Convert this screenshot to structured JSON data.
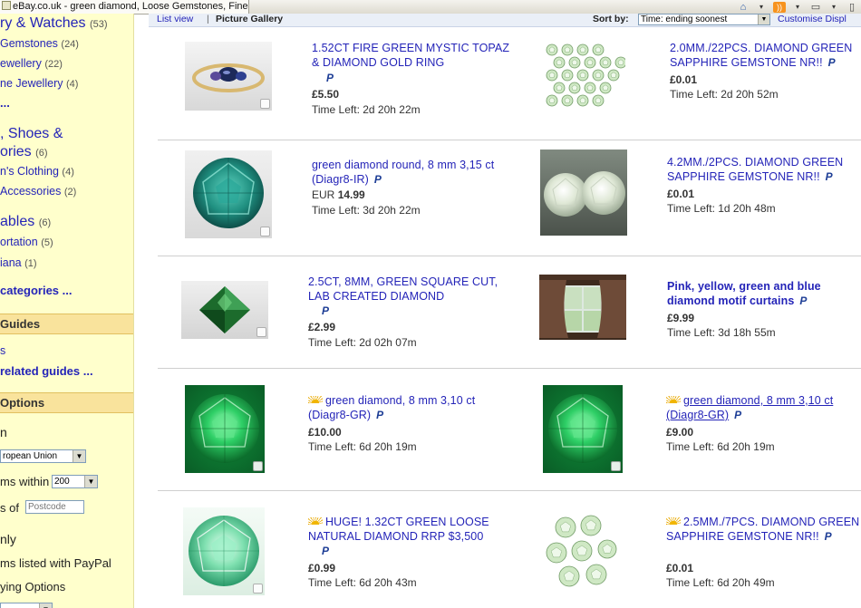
{
  "browser": {
    "tab_title": "eBay.co.uk - green diamond, Loose Gemstones, Fine ...",
    "icons": [
      "home-icon",
      "rss-icon",
      "print-icon"
    ]
  },
  "sidebar": {
    "categories": [
      {
        "label": "ry & Watches",
        "count": "(53)",
        "size": "large"
      },
      {
        "label": "Gemstones",
        "count": "(24)"
      },
      {
        "label": "ewellery",
        "count": "(22)"
      },
      {
        "label": "ne Jewellery",
        "count": "(4)"
      },
      {
        "label": "..."
      },
      {
        "label": ", Shoes &",
        "size": "large"
      },
      {
        "label": "ories",
        "count": "(6)",
        "size": "large"
      },
      {
        "label": "n's Clothing",
        "count": "(4)"
      },
      {
        "label": "Accessories",
        "count": "(2)"
      },
      {
        "label": "ables",
        "count": "(6)",
        "size": "large"
      },
      {
        "label": "ortation",
        "count": "(5)"
      },
      {
        "label": "iana",
        "count": "(1)"
      }
    ],
    "more_categories": "categories ...",
    "guides_header": "Guides",
    "guides_link": "s",
    "related_guides": "related guides ...",
    "options_header": "Options",
    "options_n": "n",
    "location_select": "ropean Union",
    "items_within_label": "ms within",
    "distance_select": "200",
    "postcode_label": "s of",
    "postcode_placeholder": "Postcode",
    "only_label": "nly",
    "paypal_label": "ms listed with PayPal",
    "buying_options": "ying Options"
  },
  "viewbar": {
    "list_view": "List view",
    "separator": "|",
    "picture_gallery": "Picture Gallery",
    "sort_label": "Sort by:",
    "sort_value": "Time: ending soonest",
    "customise": "Customise Displ"
  },
  "paypal_badge": "P",
  "items": [
    {
      "title": "1.52CT FIRE GREEN MYSTIC TOPAZ & DIAMOND GOLD RING",
      "price": "£5.50",
      "time_left": "Time Left: 2d 20h 22m",
      "thumb": "ring"
    },
    {
      "title": "2.0MM./22PCS. DIAMOND GREEN SAPPHIRE GEMSTONE NR!!",
      "price": "£0.01",
      "time_left": "Time Left: 2d 20h 52m",
      "thumb": "many-gems"
    },
    {
      "title": "green diamond round, 8 mm 3,15 ct (Diagr8-IR)",
      "price_currency": "EUR",
      "price": "14.99",
      "time_left": "Time Left: 3d 20h 22m",
      "thumb": "teal-round"
    },
    {
      "title": "4.2MM./2PCS. DIAMOND GREEN SAPPHIRE GEMSTONE NR!!",
      "price": "£0.01",
      "time_left": "Time Left: 1d 20h 48m",
      "thumb": "two-gems"
    },
    {
      "title": "2.5CT, 8MM, GREEN SQUARE CUT, LAB CREATED DIAMOND",
      "price": "£2.99",
      "time_left": "Time Left: 2d 02h 07m",
      "thumb": "square"
    },
    {
      "title": "Pink, yellow, green and blue diamond motif curtains",
      "price": "£9.99",
      "time_left": "Time Left: 3d 18h 55m",
      "thumb": "curtains"
    },
    {
      "title": "green diamond, 8 mm 3,10 ct (Diagr8-GR)",
      "price": "£10.00",
      "time_left": "Time Left: 6d 20h 19m",
      "thumb": "emerald-round"
    },
    {
      "title": "green diamond, 8 mm 3,10 ct (Diagr8-GR)",
      "price": "£9.00",
      "time_left": "Time Left: 6d 20h 19m",
      "thumb": "emerald-round"
    },
    {
      "title": "HUGE! 1.32CT GREEN LOOSE NATURAL DIAMOND RRP $3,500",
      "price": "£0.99",
      "time_left": "Time Left: 6d 20h 43m",
      "thumb": "mint-round"
    },
    {
      "title": "2.5MM./7PCS. DIAMOND GREEN SAPPHIRE GEMSTONE NR!!",
      "price": "£0.01",
      "time_left": "Time Left: 6d 20h 49m",
      "thumb": "seven-gems"
    }
  ]
}
